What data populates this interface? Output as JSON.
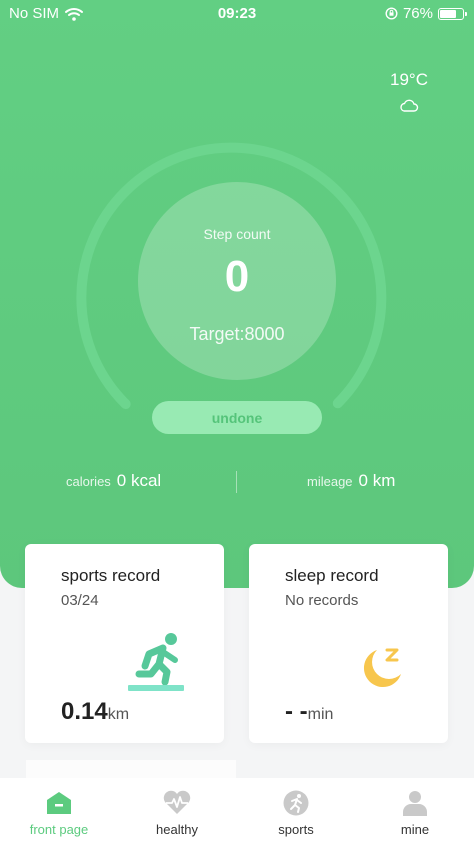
{
  "status_bar": {
    "carrier": "No SIM",
    "time": "09:23",
    "battery_label": "76%",
    "battery_level": 0.76
  },
  "weather": {
    "temperature": "19°C",
    "icon": "cloud-icon"
  },
  "steps": {
    "label": "Step count",
    "value": "0",
    "target": "Target:8000",
    "progress": 0
  },
  "status_button": "undone",
  "stats": {
    "calories_label": "calories",
    "calories_value": "0 kcal",
    "mileage_label": "mileage",
    "mileage_value": "0 km"
  },
  "cards": {
    "sports": {
      "title": "sports record",
      "subtitle": "03/24",
      "value": "0.14",
      "unit": "km",
      "icon": "running-icon"
    },
    "sleep": {
      "title": "sleep record",
      "subtitle": "No records",
      "value": "- -",
      "unit": "min",
      "icon": "moon-icon"
    }
  },
  "tabs": [
    {
      "label": "front page",
      "icon": "home-icon",
      "active": true
    },
    {
      "label": "healthy",
      "icon": "heart-icon",
      "active": false
    },
    {
      "label": "sports",
      "icon": "runner-icon",
      "active": false
    },
    {
      "label": "mine",
      "icon": "person-icon",
      "active": false
    }
  ],
  "colors": {
    "primary": "#5ecc80",
    "active_tab": "#5ccb7f",
    "button_bg": "#98eab3",
    "sleep_icon": "#f7c64d"
  }
}
